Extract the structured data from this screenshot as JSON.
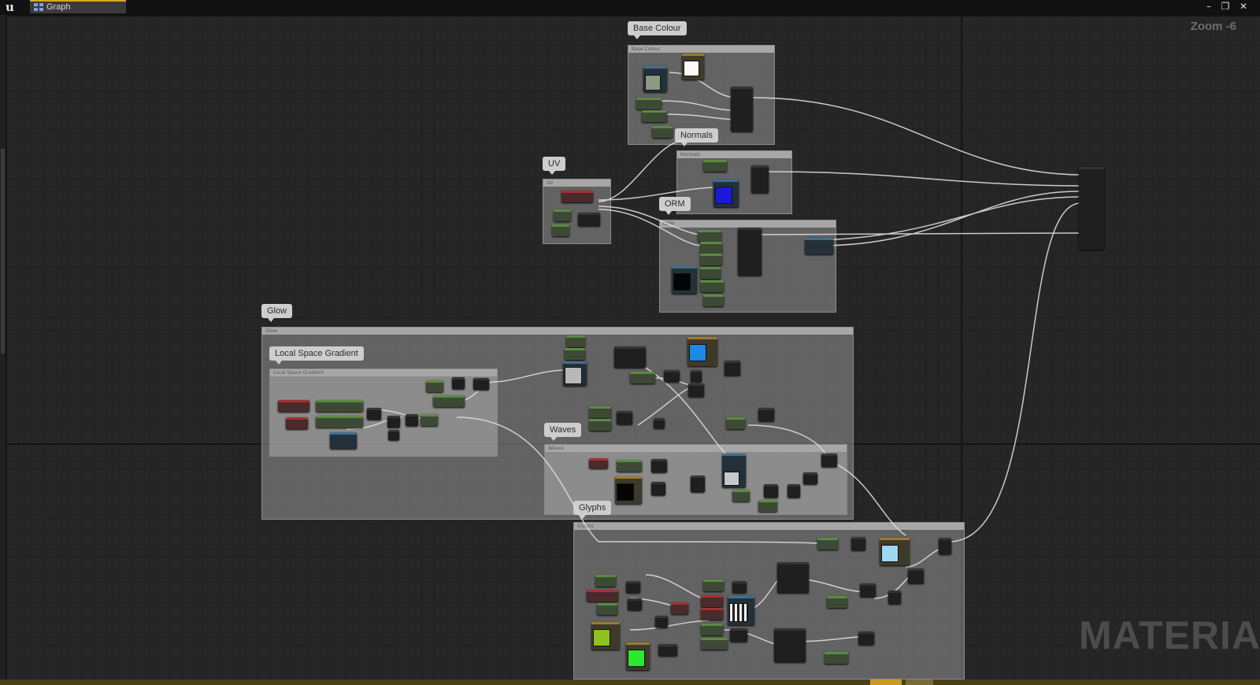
{
  "window": {
    "tab_label": "Graph",
    "tab_icon": "graph-icon",
    "logo_icon": "unreal-logo-icon",
    "minimize_glyph": "–",
    "restore_glyph": "❐",
    "close_glyph": "✕"
  },
  "graph": {
    "zoom_label": "Zoom -6",
    "watermark": "MATERIAL"
  },
  "comments": {
    "base_colour": "Base Colour",
    "normals": "Normals",
    "uv": "UV",
    "orm": "ORM",
    "glow": "Glow",
    "local_space_gradient": "Local Space Gradient",
    "waves": "Waves",
    "glyphs": "Glyphs"
  },
  "colors": {
    "graph_background": "#262626",
    "comment_box": "#969696",
    "scalar_parameter": "#5c8a43",
    "vector_parameter": "#a23232",
    "texture_sample": "#3f6f8f",
    "tab_accent": "#d7a82a"
  }
}
